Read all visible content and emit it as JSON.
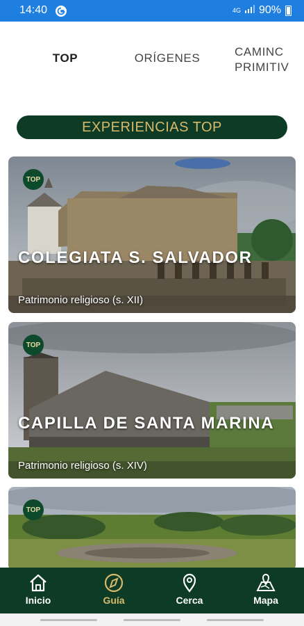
{
  "status_bar": {
    "time": "14:40",
    "network": "4G",
    "battery": "90%",
    "app_icon": "g-icon"
  },
  "tabs": [
    {
      "label": "TOP",
      "active": true
    },
    {
      "label": "ORÍGENES",
      "active": false
    },
    {
      "label": "CAMINC\nPRIMITIV",
      "active": false
    }
  ],
  "section_title": "EXPERIENCIAS TOP",
  "cards": [
    {
      "badge": "TOP",
      "title": "COLEGIATA S. SALVADOR",
      "subtitle": "Patrimonio religioso (s. XII)"
    },
    {
      "badge": "TOP",
      "title": "CAPILLA DE SANTA MARINA",
      "subtitle": "Patrimonio religioso (s. XIV)"
    },
    {
      "badge": "TOP",
      "title": "",
      "subtitle": ""
    }
  ],
  "bottom_nav": [
    {
      "label": "Inicio",
      "icon": "home-icon",
      "active": false
    },
    {
      "label": "Guía",
      "icon": "compass-icon",
      "active": true
    },
    {
      "label": "Cerca",
      "icon": "location-pin-icon",
      "active": false
    },
    {
      "label": "Mapa",
      "icon": "map-icon",
      "active": false
    }
  ],
  "colors": {
    "status_bar": "#1f7fe0",
    "brand_green": "#0d3b26",
    "accent_gold": "#d9ba6a"
  }
}
